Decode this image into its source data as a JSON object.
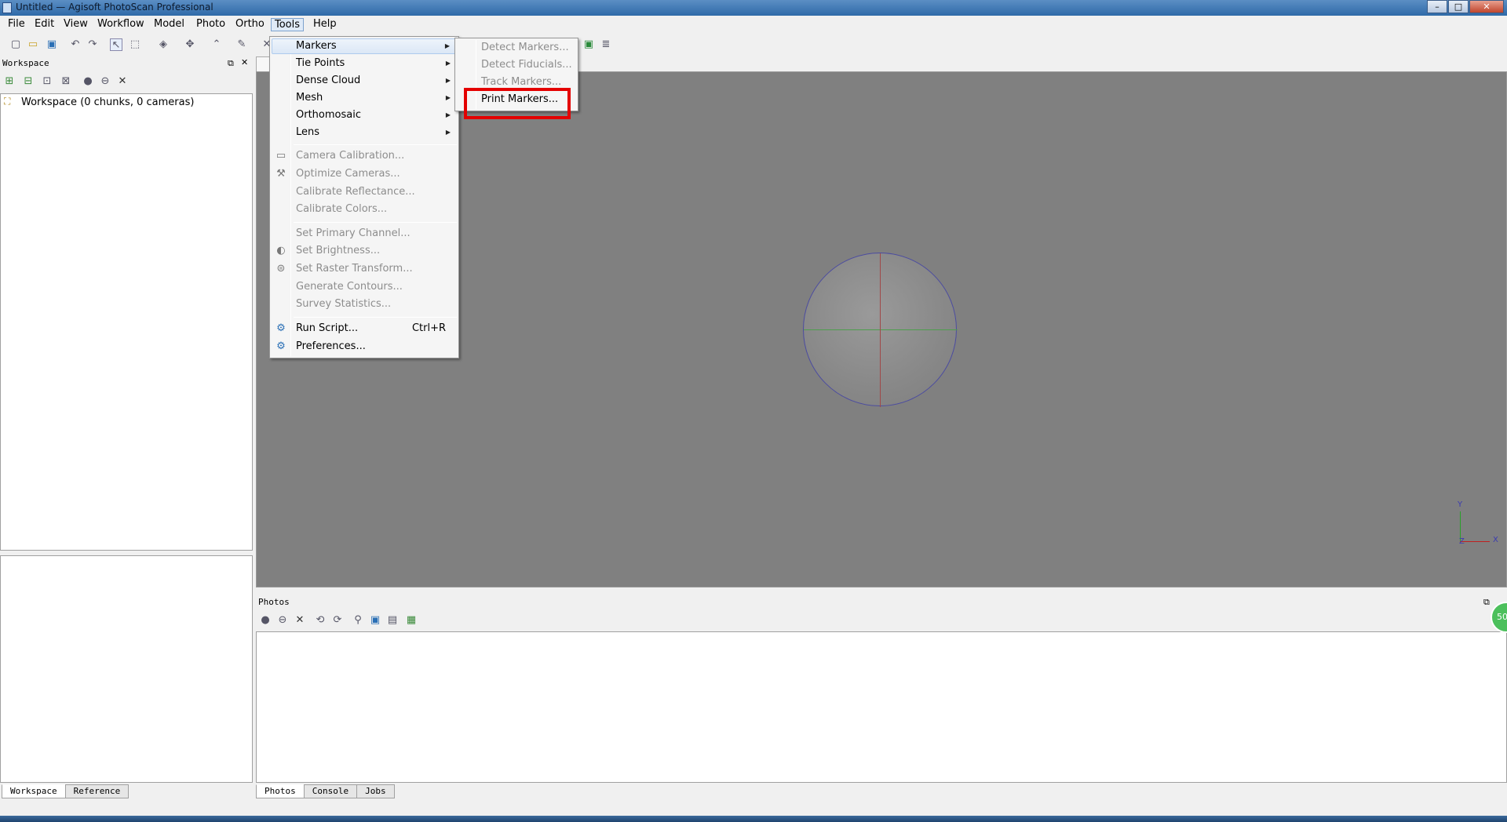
{
  "window": {
    "title": "Untitled — Agisoft PhotoScan Professional",
    "min": "–",
    "max": "□",
    "close": "✕"
  },
  "menubar": [
    "File",
    "Edit",
    "View",
    "Workflow",
    "Model",
    "Photo",
    "Ortho",
    "Tools",
    "Help"
  ],
  "workspace": {
    "title": "Workspace",
    "tree_item": "Workspace (0 chunks, 0 cameras)",
    "tabs": [
      "Workspace",
      "Reference"
    ]
  },
  "photos": {
    "title": "Photos",
    "tabs": [
      "Photos",
      "Console",
      "Jobs"
    ]
  },
  "viewport": {
    "axis_x": "X",
    "axis_y": "Y",
    "axis_z": "Z"
  },
  "tools_menu": {
    "submenus": [
      "Markers",
      "Tie Points",
      "Dense Cloud",
      "Mesh",
      "Orthomosaic",
      "Lens"
    ],
    "group1": [
      "Camera Calibration...",
      "Optimize Cameras...",
      "Calibrate Reflectance...",
      "Calibrate Colors..."
    ],
    "group2": [
      "Set Primary Channel...",
      "Set Brightness...",
      "Set Raster Transform...",
      "Generate Contours...",
      "Survey Statistics..."
    ],
    "run_script": "Run Script...",
    "run_script_shortcut": "Ctrl+R",
    "preferences": "Preferences..."
  },
  "markers_menu": [
    "Detect Markers...",
    "Detect Fiducials...",
    "Track Markers...",
    "Print Markers..."
  ],
  "badge": "50"
}
